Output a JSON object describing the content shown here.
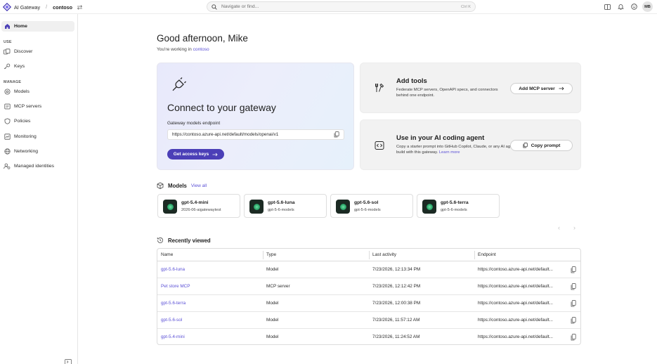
{
  "topbar": {
    "app_name": "AI Gateway",
    "separator": "/",
    "tenant": "contoso",
    "search_placeholder": "Navigate or find...",
    "search_shortcut": "Ctrl K",
    "avatar_initials": "MB"
  },
  "sidebar": {
    "home": "Home",
    "section_use": "USE",
    "discover": "Discover",
    "keys": "Keys",
    "section_manage": "MANAGE",
    "models": "Models",
    "mcp_servers": "MCP servers",
    "policies": "Policies",
    "monitoring": "Monitoring",
    "networking": "Networking",
    "managed_identities": "Managed identities"
  },
  "greeting": {
    "title": "Good afternoon, Mike",
    "sub_prefix": "You're working in ",
    "sub_link": "contoso"
  },
  "connect_card": {
    "title": "Connect to your gateway",
    "endpoint_label": "Gateway models endpoint",
    "endpoint_value": "https://contoso.azure-api.net/default/models/openai/v1",
    "button": "Get access keys"
  },
  "tools_card": {
    "title": "Add tools",
    "description": "Federate MCP servers, OpenAPI specs, and connectors behind one endpoint.",
    "button": "Add MCP server"
  },
  "coding_card": {
    "title": "Use in your AI coding agent",
    "description": "Copy a starter prompt into GitHub Copilot, Claude, or any AI agent to build with this gateway.",
    "link": "Learn more",
    "button": "Copy prompt"
  },
  "models_section": {
    "title": "Models",
    "view_all": "View all",
    "items": [
      {
        "name": "gpt-5.4-mini",
        "sub": "2026-06-aigatewaytest"
      },
      {
        "name": "gpt-5.6-luna",
        "sub": "gpt-5-6-models"
      },
      {
        "name": "gpt-5.6-sol",
        "sub": "gpt-5-6-models"
      },
      {
        "name": "gpt-5.6-terra",
        "sub": "gpt-5-6-models"
      }
    ],
    "prev": "‹",
    "next": "›"
  },
  "recent_section": {
    "title": "Recently viewed",
    "columns": [
      "Name",
      "Type",
      "Last activity",
      "Endpoint"
    ],
    "rows": [
      {
        "name": "gpt-5.6-luna",
        "type": "Model",
        "last_activity": "7/23/2026, 12:13:34 PM",
        "endpoint": "https://contoso.azure-api.net/default..."
      },
      {
        "name": "Pet store MCP",
        "type": "MCP server",
        "last_activity": "7/23/2026, 12:12:42 PM",
        "endpoint": "https://contoso.azure-api.net/default..."
      },
      {
        "name": "gpt-5.6-terra",
        "type": "Model",
        "last_activity": "7/23/2026, 12:00:38 PM",
        "endpoint": "https://contoso.azure-api.net/default..."
      },
      {
        "name": "gpt-5.6-sol",
        "type": "Model",
        "last_activity": "7/23/2026, 11:57:12 AM",
        "endpoint": "https://contoso.azure-api.net/default..."
      },
      {
        "name": "gpt-5.4-mini",
        "type": "Model",
        "last_activity": "7/23/2026, 11:24:52 AM",
        "endpoint": "https://contoso.azure-api.net/default..."
      }
    ]
  },
  "colors": {
    "accent": "#4b3fb7",
    "link": "#5b50d6"
  }
}
